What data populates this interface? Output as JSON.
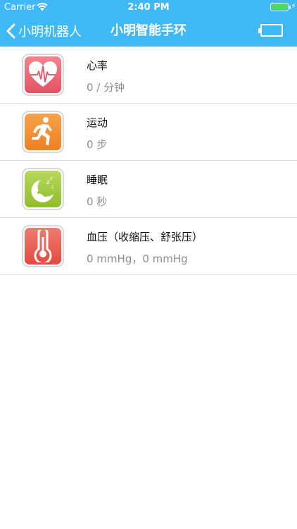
{
  "status_bar": {
    "carrier": "Carrier",
    "time": "2:40 PM",
    "wifi_icon": "wifi-icon",
    "battery_icon": "battery-charging-icon"
  },
  "nav": {
    "back_label": "小明机器人",
    "title": "小明智能手环",
    "back_icon": "chevron-left-icon",
    "battery_icon": "battery-empty-icon"
  },
  "items": [
    {
      "title": "心率",
      "value": "0 / 分钟",
      "icon": "heart-rate-icon",
      "color": "#e85c6b"
    },
    {
      "title": "运动",
      "value": "0 步",
      "icon": "running-icon",
      "color": "#f08a2e"
    },
    {
      "title": "睡眠",
      "value": "0 秒",
      "icon": "sleep-moon-icon",
      "color": "#9bc63a"
    },
    {
      "title": "血压（收缩压、舒张压）",
      "value": "0 mmHg，0 mmHg",
      "icon": "thermometer-icon",
      "color": "#ec5c57"
    }
  ],
  "colors": {
    "navbar": "#3fb8f6",
    "divider": "#e3e3e3"
  }
}
